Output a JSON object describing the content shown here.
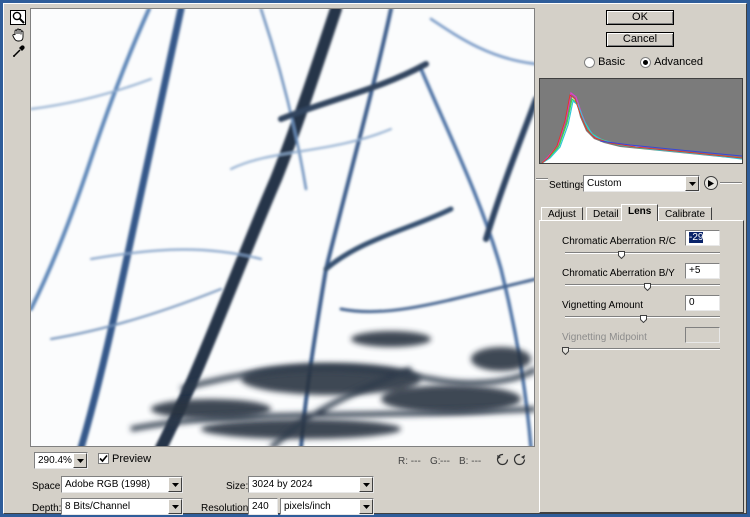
{
  "buttons": {
    "ok": "OK",
    "cancel": "Cancel"
  },
  "mode": {
    "basic_label": "Basic",
    "advanced_label": "Advanced",
    "selected": "Advanced"
  },
  "settings": {
    "label": "Settings:",
    "value": "Custom"
  },
  "tabs": [
    {
      "label": "Adjust",
      "active": false
    },
    {
      "label": "Detail",
      "active": false
    },
    {
      "label": "Lens",
      "active": true
    },
    {
      "label": "Calibrate",
      "active": false
    }
  ],
  "lens": {
    "sliders": [
      {
        "label": "Chromatic Aberration R/C",
        "value": "-29",
        "position": 0.36,
        "enabled": true
      },
      {
        "label": "Chromatic Aberration B/Y",
        "value": "+5",
        "position": 0.53,
        "enabled": true
      },
      {
        "label": "Vignetting Amount",
        "value": "0",
        "position": 0.5,
        "enabled": true
      },
      {
        "label": "Vignetting Midpoint",
        "value": "",
        "position": 0.0,
        "enabled": false
      }
    ]
  },
  "preview_bar": {
    "zoom": "290.4%",
    "preview_label": "Preview",
    "preview_checked": true,
    "r_label": "R:",
    "r_value": "---",
    "g_label": "G:",
    "g_value": "---",
    "b_label": "B:",
    "b_value": "---"
  },
  "workflow": {
    "space_label": "Space:",
    "space_value": "Adobe RGB (1998)",
    "depth_label": "Depth:",
    "depth_value": "8 Bits/Channel",
    "size_label": "Size:",
    "size_value": "3024 by 2024",
    "resolution_label": "Resolution:",
    "resolution_value": "240",
    "resolution_unit": "pixels/inch"
  },
  "colors": {
    "dialog_bg": "#d4d0c8",
    "outer_border": "#2f5d9a",
    "histogram_bg": "#7b7b7b",
    "selection": "#0a246a"
  },
  "icons": {
    "zoom_tool": "magnifier-icon",
    "hand_tool": "hand-icon",
    "eyedropper_tool": "eyedropper-icon",
    "rotate_left": "rotate-left-icon",
    "rotate_right": "rotate-right-icon",
    "settings_menu": "flyout-arrow-icon"
  }
}
